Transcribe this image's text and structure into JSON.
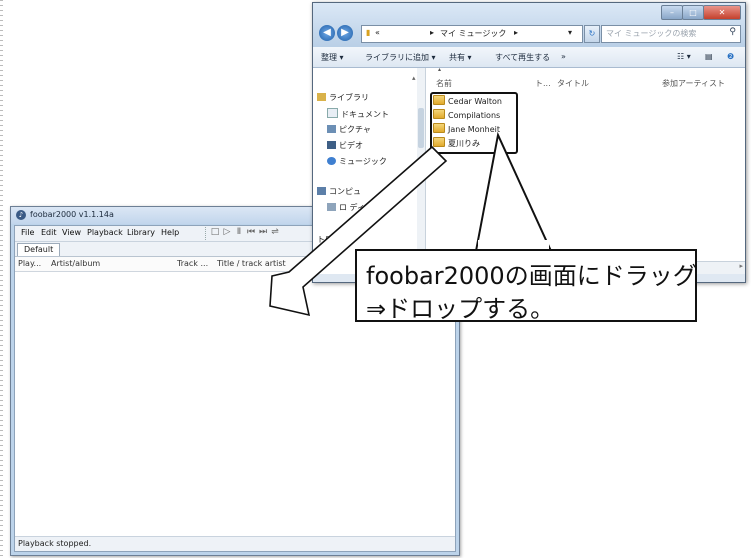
{
  "foobar": {
    "title": "foobar2000 v1.1.14a",
    "menu": [
      {
        "label": "File"
      },
      {
        "label": "Edit"
      },
      {
        "label": "View"
      },
      {
        "label": "Playback"
      },
      {
        "label": "Library"
      },
      {
        "label": "Help"
      }
    ],
    "toolbar_icons": [
      "□",
      "▷",
      "Ⅱ",
      "⏮",
      "⏭",
      "⇌"
    ],
    "tab": "Default",
    "columns": [
      "Play...",
      "Artist/album",
      "Track ...",
      "Title / track artist"
    ],
    "status": "Playback stopped."
  },
  "explorer": {
    "address": [
      "«",
      "▸",
      "マイ ミュージック",
      "▸"
    ],
    "search_placeholder": "マイ ミュージックの検索",
    "commands": [
      {
        "label": "整理 ▾"
      },
      {
        "label": "ライブラリに追加 ▾"
      },
      {
        "label": "共有 ▾"
      },
      {
        "label": "すべて再生する"
      },
      {
        "label": "»"
      }
    ],
    "tree": [
      "ライブラリ",
      "ドキュメント",
      "ピクチャ",
      "ビデオ",
      "ミュージック",
      "コンピュ",
      "ロ      ディスク",
      "   トワーク"
    ],
    "list_headers": [
      "名前",
      "ト...",
      "タイトル",
      "参加アーティスト"
    ],
    "folders": [
      "Cedar Walton",
      "Compilations",
      "Jane Monheit",
      "夏川りみ"
    ]
  },
  "callout": {
    "line1": "foobar2000の画面にドラッグ",
    "line2": "⇒ドロップする。"
  },
  "colors": {
    "frame": "#bcd3ea",
    "accent": "#2a72c4"
  }
}
